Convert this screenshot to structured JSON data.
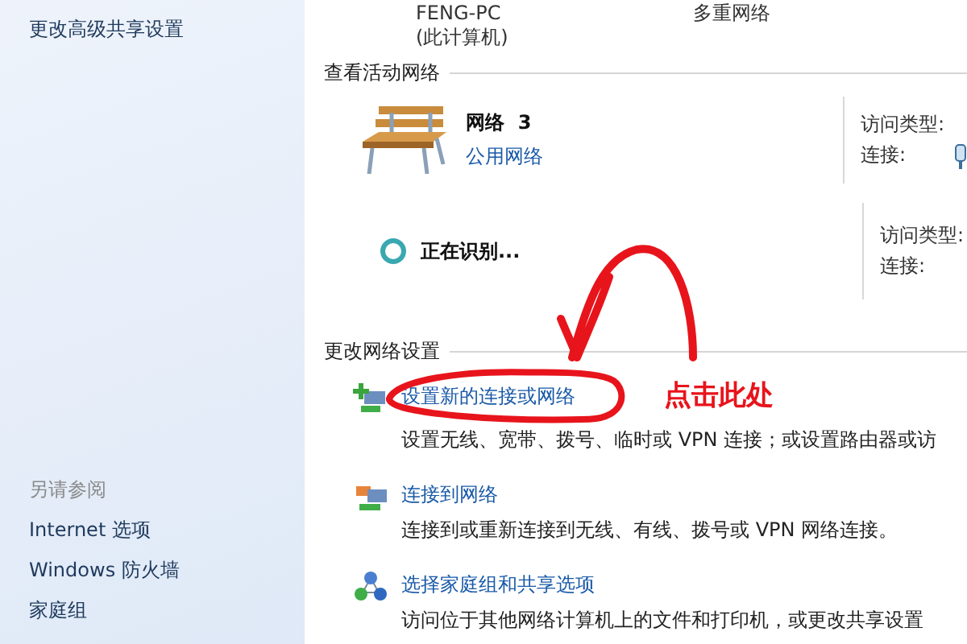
{
  "sidebar": {
    "top_links": [
      "更改高级共享设置"
    ],
    "see_also": {
      "title": "另请参阅",
      "links": [
        "Internet 选项",
        "Windows 防火墙",
        "家庭组"
      ]
    }
  },
  "computer": {
    "name": "FENG-PC",
    "note": "(此计算机)",
    "network": "多重网络"
  },
  "active_networks": {
    "title": "查看活动网络",
    "networks": [
      {
        "kind": "bench",
        "name": "网络  3",
        "category": "公用网络",
        "access_label": "访问类型:",
        "connection_label": "连接:"
      },
      {
        "kind": "identifying",
        "name": "正在识别...",
        "access_label": "访问类型:",
        "connection_label": "连接:"
      }
    ]
  },
  "change_settings": {
    "title": "更改网络设置",
    "tasks": [
      {
        "kind": "setup",
        "link": "设置新的连接或网络",
        "description": "设置无线、宽带、拨号、临时或 VPN 连接；或设置路由器或访"
      },
      {
        "kind": "connect",
        "link": "连接到网络",
        "description": "连接到或重新连接到无线、有线、拨号或 VPN 网络连接。"
      },
      {
        "kind": "homegroup",
        "link": "选择家庭组和共享选项",
        "description": "访问位于其他网络计算机上的文件和打印机，或更改共享设置"
      }
    ]
  },
  "annotation": {
    "text": "点击此处"
  }
}
